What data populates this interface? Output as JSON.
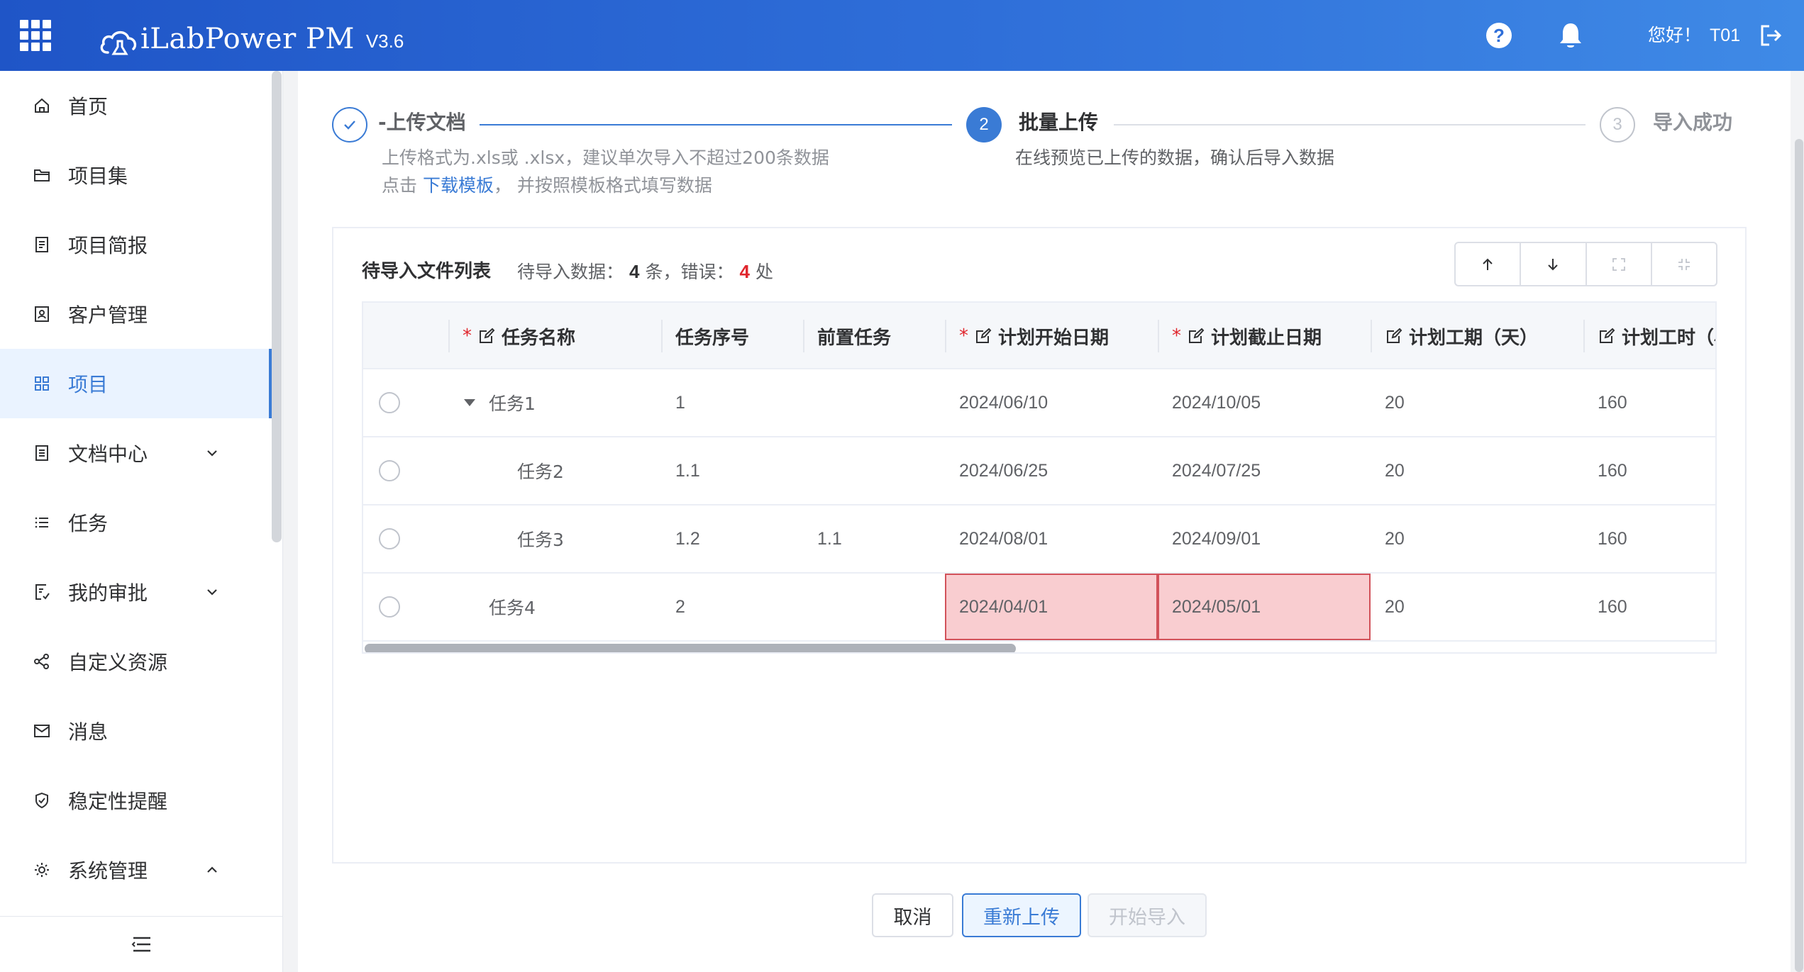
{
  "header": {
    "app_name": "iLabPower PM",
    "version": "V3.6",
    "greeting": "您好！",
    "username": "T01",
    "help_glyph": "?"
  },
  "sidebar": {
    "items": [
      {
        "label": "首页",
        "icon": "home-icon"
      },
      {
        "label": "项目集",
        "icon": "folder-icon"
      },
      {
        "label": "项目简报",
        "icon": "report-icon"
      },
      {
        "label": "客户管理",
        "icon": "customer-icon"
      },
      {
        "label": "项目",
        "icon": "grid-icon",
        "active": true
      },
      {
        "label": "文档中心",
        "icon": "document-icon",
        "arrow": "down"
      },
      {
        "label": "任务",
        "icon": "list-icon"
      },
      {
        "label": "我的审批",
        "icon": "approval-icon",
        "arrow": "down"
      },
      {
        "label": "自定义资源",
        "icon": "share-icon"
      },
      {
        "label": "消息",
        "icon": "mail-icon"
      },
      {
        "label": "稳定性提醒",
        "icon": "shield-icon"
      },
      {
        "label": "系统管理",
        "icon": "gear-icon",
        "arrow": "up"
      }
    ]
  },
  "steps": {
    "step1": {
      "title": "-上传文档",
      "desc1": "上传格式为.xls或 .xlsx，建议单次导入不超过200条数据",
      "desc2_prefix": "点击 ",
      "desc2_link": "下载模板",
      "desc2_suffix": "， 并按照模板格式填写数据"
    },
    "step2": {
      "number": "2",
      "title": "批量上传",
      "desc": "在线预览已上传的数据，确认后导入数据"
    },
    "step3": {
      "number": "3",
      "title": "导入成功"
    }
  },
  "panel": {
    "title": "待导入文件列表",
    "stats_prefix": "待导入数据：",
    "data_count": "4",
    "stats_mid": "条，错误：",
    "error_count": "4",
    "stats_suffix": "处"
  },
  "table": {
    "columns": [
      "任务名称",
      "任务序号",
      "前置任务",
      "计划开始日期",
      "计划截止日期",
      "计划工期（天）",
      "计划工时（小"
    ],
    "rows": [
      {
        "name": "任务1",
        "seq": "1",
        "pre": "",
        "start": "2024/06/10",
        "end": "2024/10/05",
        "days": "20",
        "hours": "160"
      },
      {
        "name": "任务2",
        "seq": "1.1",
        "pre": "",
        "start": "2024/06/25",
        "end": "2024/07/25",
        "days": "20",
        "hours": "160"
      },
      {
        "name": "任务3",
        "seq": "1.2",
        "pre": "1.1",
        "start": "2024/08/01",
        "end": "2024/09/01",
        "days": "20",
        "hours": "160"
      },
      {
        "name": "任务4",
        "seq": "2",
        "pre": "",
        "start": "2024/04/01",
        "end": "2024/05/01",
        "days": "20",
        "hours": "160"
      }
    ]
  },
  "buttons": {
    "cancel": "取消",
    "reupload": "重新上传",
    "import": "开始导入"
  },
  "colors": {
    "primary": "#3a7bd5",
    "error_bg": "#f9cdd0",
    "error_border": "#d2525a",
    "header_start": "#1f55c7",
    "header_end": "#3f8ae6"
  }
}
